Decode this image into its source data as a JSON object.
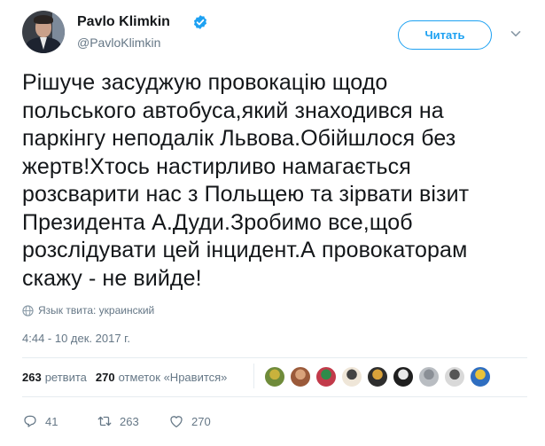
{
  "author": {
    "display_name": "Pavlo Klimkin",
    "handle": "@PavloKlimkin",
    "verified": true
  },
  "header": {
    "follow_label": "Читать"
  },
  "tweet": {
    "text_lines": [
      "Рішуче засуджую провокацію щодо",
      "польського автобуса,який знаходився на",
      "паркінгу неподалік Львова.Обійшлося без",
      "жертв!Хтось настирливо намагається",
      "розсварити нас з Польщею та зірвати візит",
      "Президента А.Дуди.Зробимо все,щоб",
      "розслідувати цей інцидент.А провокаторам",
      "скажу - не вийде!"
    ],
    "language_note": "Язык твита: украинский",
    "timestamp": "4:44 - 10 дек. 2017 г."
  },
  "stats": {
    "retweets_count": "263",
    "retweets_label": "ретвита",
    "likes_count": "270",
    "likes_label": "отметок «Нравится»"
  },
  "likers": [
    {
      "color": "#6f8b3a",
      "accent": "#c9b23c"
    },
    {
      "color": "#9b5a3a",
      "accent": "#d9a27a"
    },
    {
      "color": "#c23a4a",
      "accent": "#2e8b4a"
    },
    {
      "color": "#efe6d8",
      "accent": "#444444"
    },
    {
      "color": "#2e2e2e",
      "accent": "#d9a23a"
    },
    {
      "color": "#1f1f1f",
      "accent": "#e8e8e8"
    },
    {
      "color": "#b9bdc2",
      "accent": "#8a8f96"
    },
    {
      "color": "#d9d9d9",
      "accent": "#555555"
    },
    {
      "color": "#2f6ec0",
      "accent": "#e8c23a"
    }
  ],
  "actions": {
    "reply_count": "41",
    "retweet_count": "263",
    "like_count": "270"
  },
  "colors": {
    "accent": "#1da1f2",
    "text": "#14171a",
    "muted": "#657786",
    "divider": "#e6ecf0"
  },
  "icons": [
    "verified-icon",
    "chevron-down-icon",
    "globe-icon",
    "reply-icon",
    "retweet-icon",
    "heart-icon"
  ]
}
